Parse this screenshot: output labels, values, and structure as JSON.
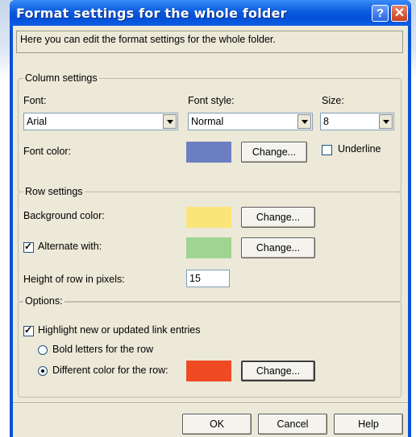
{
  "window": {
    "title": "Format settings for the whole folder"
  },
  "titlebar": {
    "help_glyph": "?",
    "close_glyph": "✕"
  },
  "info_text": "Here you can edit the format settings for the whole folder.",
  "column": {
    "group_label": "Column settings",
    "font_label": "Font:",
    "font_value": "Arial",
    "style_label": "Font style:",
    "style_value": "Normal",
    "size_label": "Size:",
    "size_value": "8",
    "font_color_label": "Font color:",
    "font_color": "#6b7fc0",
    "change_label": "Change...",
    "underline_label": "Underline",
    "underline_checked": false
  },
  "row": {
    "group_label": "Row settings",
    "bg_label": "Background color:",
    "bg_color": "#fbe57a",
    "change_label": "Change...",
    "alternate_label": "Alternate with:",
    "alternate_checked": true,
    "alternate_color": "#9fd492",
    "height_label": "Height of row in pixels:",
    "height_value": "15"
  },
  "options": {
    "group_label": "Options:",
    "highlight_label": "Highlight new or updated link entries",
    "highlight_checked": true,
    "bold_label": "Bold letters for the row",
    "different_label": "Different color for the row:",
    "different_color": "#ef4a24",
    "change_label": "Change..."
  },
  "footer": {
    "ok_label": "OK",
    "cancel_label": "Cancel",
    "help_label": "Help"
  },
  "colors": {
    "titlebar": "#0550d8",
    "face": "#ece9d8"
  }
}
